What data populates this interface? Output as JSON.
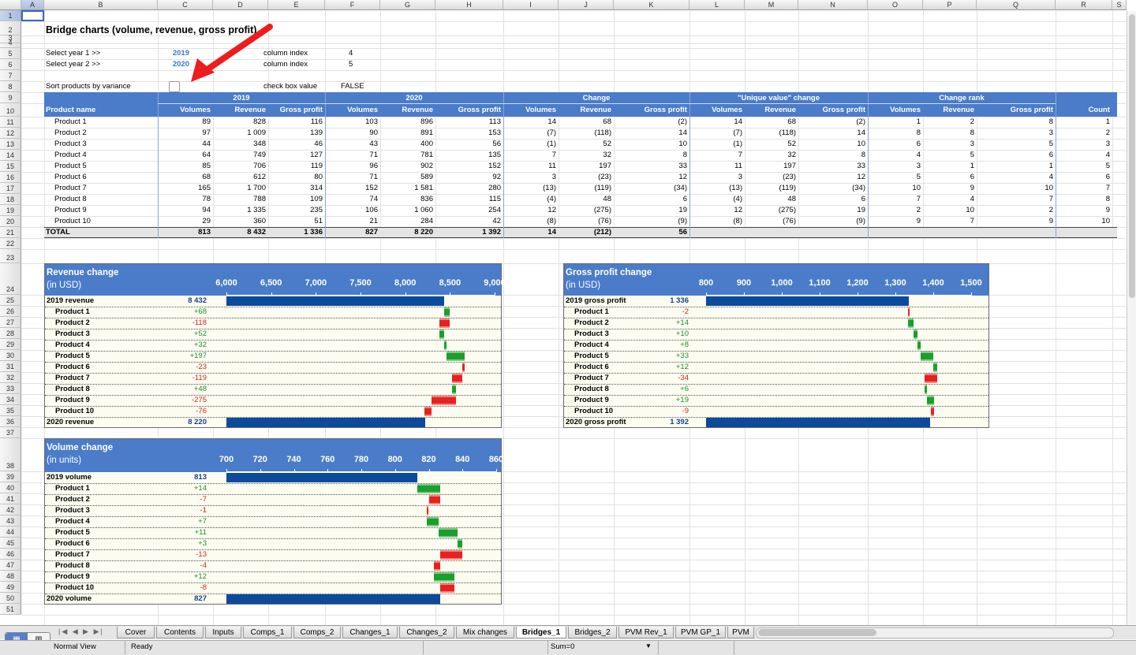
{
  "columns": [
    "A",
    "B",
    "C",
    "D",
    "E",
    "F",
    "G",
    "H",
    "I",
    "J",
    "K",
    "L",
    "M",
    "N",
    "O",
    "P",
    "Q",
    "R",
    "S"
  ],
  "rows": [
    "1",
    "2",
    "3",
    "4",
    "5",
    "6",
    "7",
    "8",
    "9",
    "10",
    "11",
    "12",
    "13",
    "14",
    "15",
    "16",
    "17",
    "18",
    "19",
    "20",
    "21",
    "22",
    "23",
    "24",
    "25",
    "26",
    "27",
    "28",
    "29",
    "30",
    "31",
    "32",
    "33",
    "34",
    "35",
    "36",
    "37",
    "38",
    "39",
    "40",
    "41",
    "42",
    "43",
    "44",
    "45",
    "46",
    "47",
    "48",
    "49",
    "50",
    "51"
  ],
  "title": "Bridge charts (volume, revenue, gross profit)",
  "controls": {
    "year1_label": "Select year 1 >>",
    "year1_value": "2019",
    "year2_label": "Select year 2 >>",
    "year2_value": "2020",
    "sort_label": "Sort products by variance",
    "colidx_label1": "column index",
    "colidx_value1": "4",
    "colidx_label2": "column index",
    "colidx_value2": "5",
    "checkbox_label": "check box value",
    "checkbox_value": "FALSE"
  },
  "table": {
    "group_headers": [
      "2019",
      "2020",
      "Change",
      "\"Unique value\" change",
      "Change rank"
    ],
    "first_header": "Product name",
    "sub_headers": [
      "Volumes",
      "Revenue",
      "Gross profit",
      "Volumes",
      "Revenue",
      "Gross profit",
      "Volumes",
      "Revenue",
      "Gross profit",
      "Volumes",
      "Revenue",
      "Gross profit",
      "Volumes",
      "Revenue",
      "Gross profit",
      "Count"
    ],
    "rows": [
      [
        "Product 1",
        "89",
        "828",
        "116",
        "103",
        "896",
        "113",
        "14",
        "68",
        "(2)",
        "14",
        "68",
        "(2)",
        "1",
        "2",
        "8",
        "1"
      ],
      [
        "Product 2",
        "97",
        "1 009",
        "139",
        "90",
        "891",
        "153",
        "(7)",
        "(118)",
        "14",
        "(7)",
        "(118)",
        "14",
        "8",
        "8",
        "3",
        "2"
      ],
      [
        "Product 3",
        "44",
        "348",
        "46",
        "43",
        "400",
        "56",
        "(1)",
        "52",
        "10",
        "(1)",
        "52",
        "10",
        "6",
        "3",
        "5",
        "3"
      ],
      [
        "Product 4",
        "64",
        "749",
        "127",
        "71",
        "781",
        "135",
        "7",
        "32",
        "8",
        "7",
        "32",
        "8",
        "4",
        "5",
        "6",
        "4"
      ],
      [
        "Product 5",
        "85",
        "706",
        "119",
        "96",
        "902",
        "152",
        "11",
        "197",
        "33",
        "11",
        "197",
        "33",
        "3",
        "1",
        "1",
        "5"
      ],
      [
        "Product 6",
        "68",
        "612",
        "80",
        "71",
        "589",
        "92",
        "3",
        "(23)",
        "12",
        "3",
        "(23)",
        "12",
        "5",
        "6",
        "4",
        "6"
      ],
      [
        "Product 7",
        "165",
        "1 700",
        "314",
        "152",
        "1 581",
        "280",
        "(13)",
        "(119)",
        "(34)",
        "(13)",
        "(119)",
        "(34)",
        "10",
        "9",
        "10",
        "7"
      ],
      [
        "Product 8",
        "78",
        "788",
        "109",
        "74",
        "836",
        "115",
        "(4)",
        "48",
        "6",
        "(4)",
        "48",
        "6",
        "7",
        "4",
        "7",
        "8"
      ],
      [
        "Product 9",
        "94",
        "1 335",
        "235",
        "106",
        "1 060",
        "254",
        "12",
        "(275)",
        "19",
        "12",
        "(275)",
        "19",
        "2",
        "10",
        "2",
        "9"
      ],
      [
        "Product 10",
        "29",
        "360",
        "51",
        "21",
        "284",
        "42",
        "(8)",
        "(76)",
        "(9)",
        "(8)",
        "(76)",
        "(9)",
        "9",
        "7",
        "9",
        "10"
      ]
    ],
    "total": [
      "TOTAL",
      "813",
      "8 432",
      "1 336",
      "827",
      "8 220",
      "1 392",
      "14",
      "(212)",
      "56",
      "",
      "",
      "",
      "",
      "",
      "",
      ""
    ]
  },
  "charts": [
    {
      "id": "revenue",
      "title": "Revenue change",
      "subtitle": "(in USD)",
      "axis_ticks": [
        "6,000",
        "6,500",
        "7,000",
        "7,500",
        "8,000",
        "8,500",
        "9,000"
      ],
      "axis_min": 6000,
      "axis_max": 9000,
      "start_label": "2019 revenue",
      "start_value": 8432,
      "start_text": "8 432",
      "end_label": "2020 revenue",
      "end_value": 8220,
      "end_text": "8 220",
      "items": [
        {
          "label": "Product 1",
          "delta": 68,
          "text": "+68"
        },
        {
          "label": "Product 2",
          "delta": -118,
          "text": "-118"
        },
        {
          "label": "Product 3",
          "delta": 52,
          "text": "+52"
        },
        {
          "label": "Product 4",
          "delta": 32,
          "text": "+32"
        },
        {
          "label": "Product 5",
          "delta": 197,
          "text": "+197"
        },
        {
          "label": "Product 6",
          "delta": -23,
          "text": "-23"
        },
        {
          "label": "Product 7",
          "delta": -119,
          "text": "-119"
        },
        {
          "label": "Product 8",
          "delta": 48,
          "text": "+48"
        },
        {
          "label": "Product 9",
          "delta": -275,
          "text": "-275"
        },
        {
          "label": "Product 10",
          "delta": -76,
          "text": "-76"
        }
      ]
    },
    {
      "id": "gp",
      "title": "Gross profit change",
      "subtitle": "(in USD)",
      "axis_ticks": [
        "800",
        "900",
        "1,000",
        "1,100",
        "1,200",
        "1,300",
        "1,400",
        "1,500"
      ],
      "axis_min": 800,
      "axis_max": 1500,
      "start_label": "2019 gross profit",
      "start_value": 1336,
      "start_text": "1 336",
      "end_label": "2020 gross profit",
      "end_value": 1392,
      "end_text": "1 392",
      "items": [
        {
          "label": "Product 1",
          "delta": -2,
          "text": "-2"
        },
        {
          "label": "Product 2",
          "delta": 14,
          "text": "+14"
        },
        {
          "label": "Product 3",
          "delta": 10,
          "text": "+10"
        },
        {
          "label": "Product 4",
          "delta": 8,
          "text": "+8"
        },
        {
          "label": "Product 5",
          "delta": 33,
          "text": "+33"
        },
        {
          "label": "Product 6",
          "delta": 12,
          "text": "+12"
        },
        {
          "label": "Product 7",
          "delta": -34,
          "text": "-34"
        },
        {
          "label": "Product 8",
          "delta": 6,
          "text": "+6"
        },
        {
          "label": "Product 9",
          "delta": 19,
          "text": "+19"
        },
        {
          "label": "Product 10",
          "delta": -9,
          "text": "-9"
        }
      ]
    },
    {
      "id": "volume",
      "title": "Volume change",
      "subtitle": "(in units)",
      "axis_ticks": [
        "700",
        "720",
        "740",
        "760",
        "780",
        "800",
        "820",
        "840",
        "860"
      ],
      "axis_min": 700,
      "axis_max": 860,
      "start_label": "2019 volume",
      "start_value": 813,
      "start_text": "813",
      "end_label": "2020 volume",
      "end_value": 827,
      "end_text": "827",
      "items": [
        {
          "label": "Product 1",
          "delta": 14,
          "text": "+14"
        },
        {
          "label": "Product 2",
          "delta": -7,
          "text": "-7"
        },
        {
          "label": "Product 3",
          "delta": -1,
          "text": "-1"
        },
        {
          "label": "Product 4",
          "delta": 7,
          "text": "+7"
        },
        {
          "label": "Product 5",
          "delta": 11,
          "text": "+11"
        },
        {
          "label": "Product 6",
          "delta": 3,
          "text": "+3"
        },
        {
          "label": "Product 7",
          "delta": -13,
          "text": "-13"
        },
        {
          "label": "Product 8",
          "delta": -4,
          "text": "-4"
        },
        {
          "label": "Product 9",
          "delta": 12,
          "text": "+12"
        },
        {
          "label": "Product 10",
          "delta": -8,
          "text": "-8"
        }
      ]
    }
  ],
  "sheet_tabs": [
    "Cover",
    "Contents",
    "Inputs",
    "Comps_1",
    "Comps_2",
    "Changes_1",
    "Changes_2",
    "Mix changes",
    "Bridges_1",
    "Bridges_2",
    "PVM Rev_1",
    "PVM GP_1",
    "PVM"
  ],
  "active_tab": "Bridges_1",
  "status": {
    "view": "Normal View",
    "state": "Ready",
    "sum": "Sum=0"
  },
  "colors": {
    "header_blue": "#4a7cc9",
    "bar_blue": "#0c4a9c",
    "positive": "#1a9e2c",
    "negative": "#e82020",
    "chart_bg": "#fcfdf0"
  }
}
